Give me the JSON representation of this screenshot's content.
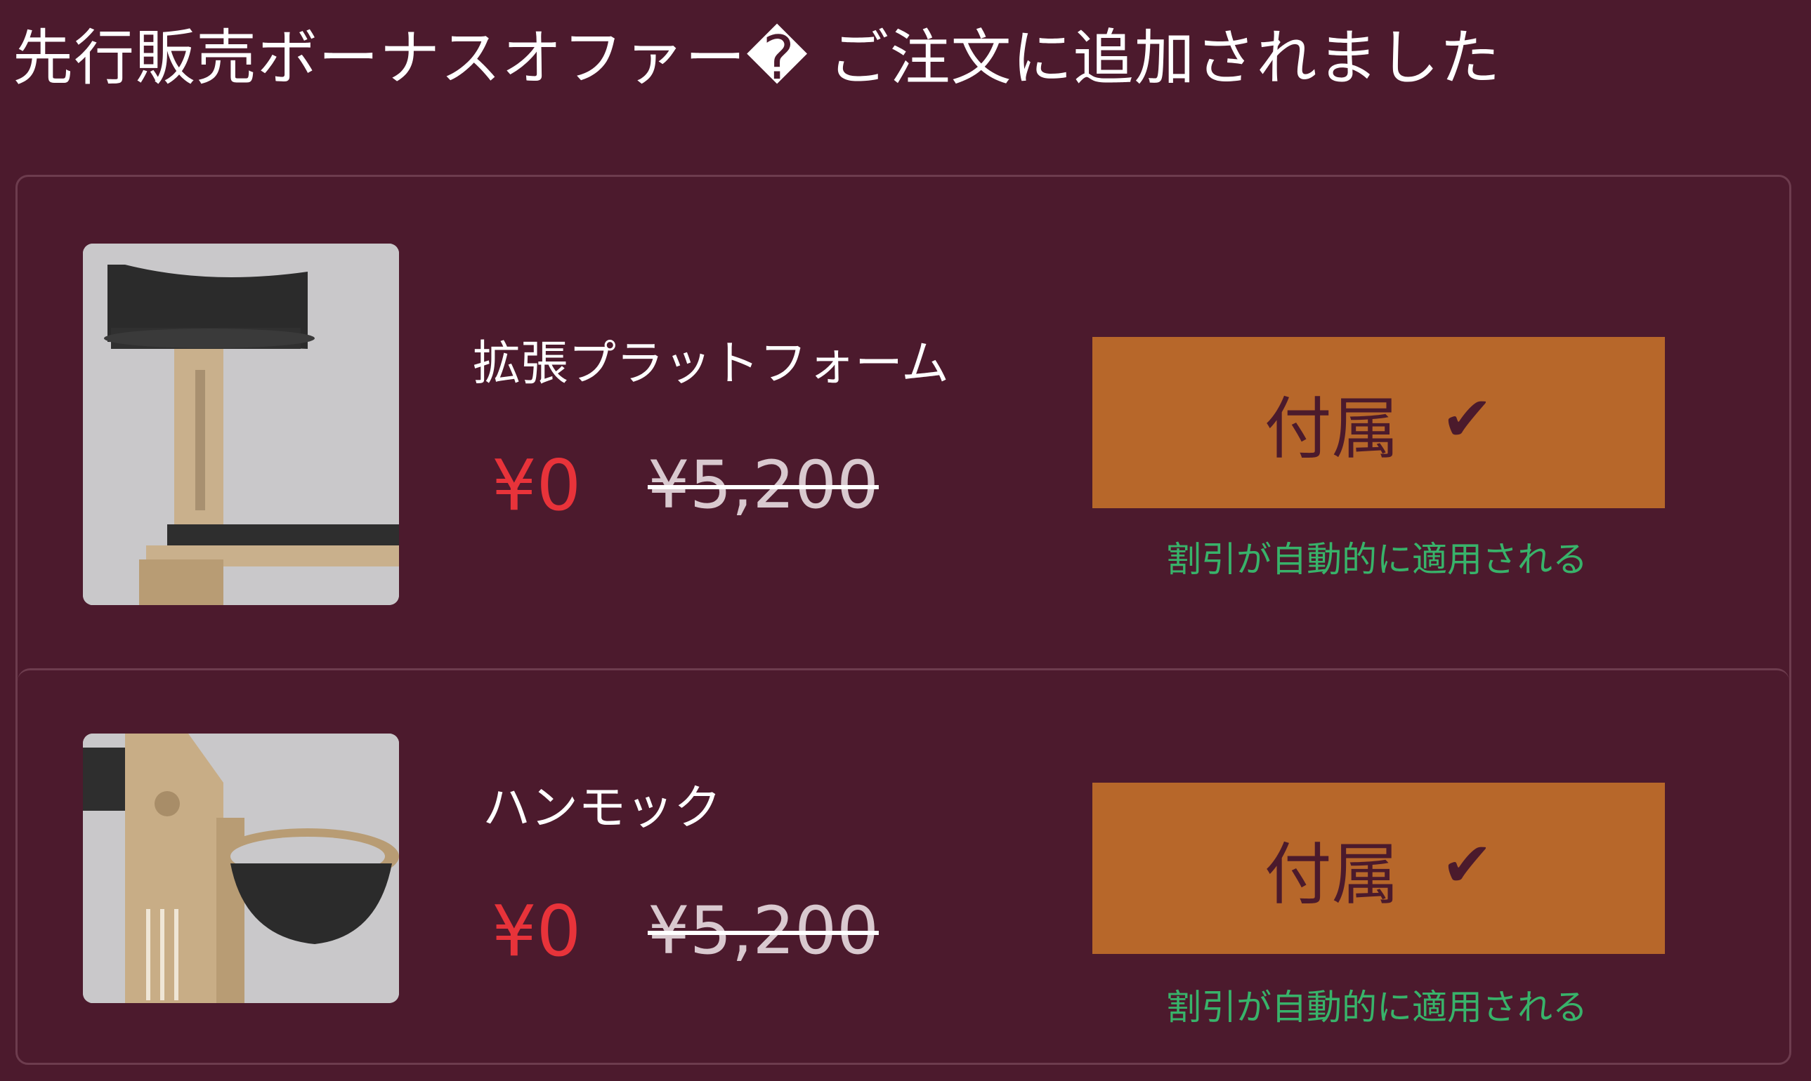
{
  "header": {
    "title": "先行販売ボーナスオファー� ご注文に追加されました"
  },
  "offers": [
    {
      "name": "拡張プラットフォーム",
      "price_now": "¥0",
      "price_was": "¥5,200",
      "button_label": "付属",
      "button_icon": "checkmark",
      "note": "割引が自動的に適用される"
    },
    {
      "name": "ハンモック",
      "price_now": "¥0",
      "price_was": "¥5,200",
      "button_label": "付属",
      "button_icon": "checkmark",
      "note": "割引が自動的に適用される"
    }
  ],
  "colors": {
    "background": "#4c1a2d",
    "button": "#b7672a",
    "price_now": "#e8333a",
    "note": "#38b36a"
  }
}
